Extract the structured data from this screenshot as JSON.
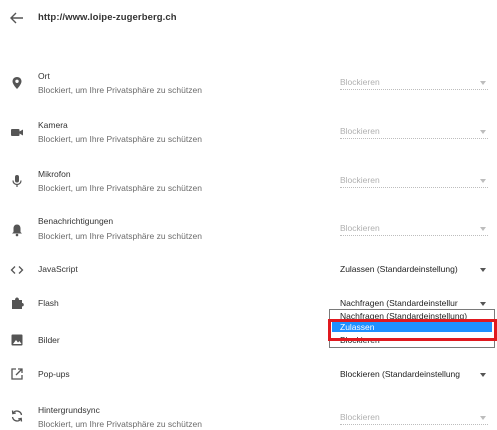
{
  "header": {
    "url": "http://www.loipe-zugerberg.ch"
  },
  "permissions": [
    {
      "title": "Ort",
      "subtitle": "Blockiert, um Ihre Privatsphäre zu schützen",
      "value": "Blockieren"
    },
    {
      "title": "Kamera",
      "subtitle": "Blockiert, um Ihre Privatsphäre zu schützen",
      "value": "Blockieren"
    },
    {
      "title": "Mikrofon",
      "subtitle": "Blockiert, um Ihre Privatsphäre zu schützen",
      "value": "Blockieren"
    },
    {
      "title": "Benachrichtigungen",
      "subtitle": "Blockiert, um Ihre Privatsphäre zu schützen",
      "value": "Blockieren"
    },
    {
      "title": "JavaScript",
      "value": "Zulassen (Standardeinstellung)"
    },
    {
      "title": "Flash",
      "value": "Nachfragen (Standardeinstellur"
    },
    {
      "title": "Bilder"
    },
    {
      "title": "Pop-ups",
      "value": "Blockieren (Standardeinstellung"
    },
    {
      "title": "Hintergrundsync",
      "subtitle": "Blockiert, um Ihre Privatsphäre zu schützen",
      "value": "Blockieren"
    }
  ],
  "flash_dropdown": {
    "options": [
      "Nachfragen (Standardeinstellung)",
      "Zulassen",
      "Blockieren"
    ],
    "highlighted": "Zulassen"
  },
  "colors": {
    "highlight": "#1e90ff",
    "annotation": "#e0191f"
  }
}
